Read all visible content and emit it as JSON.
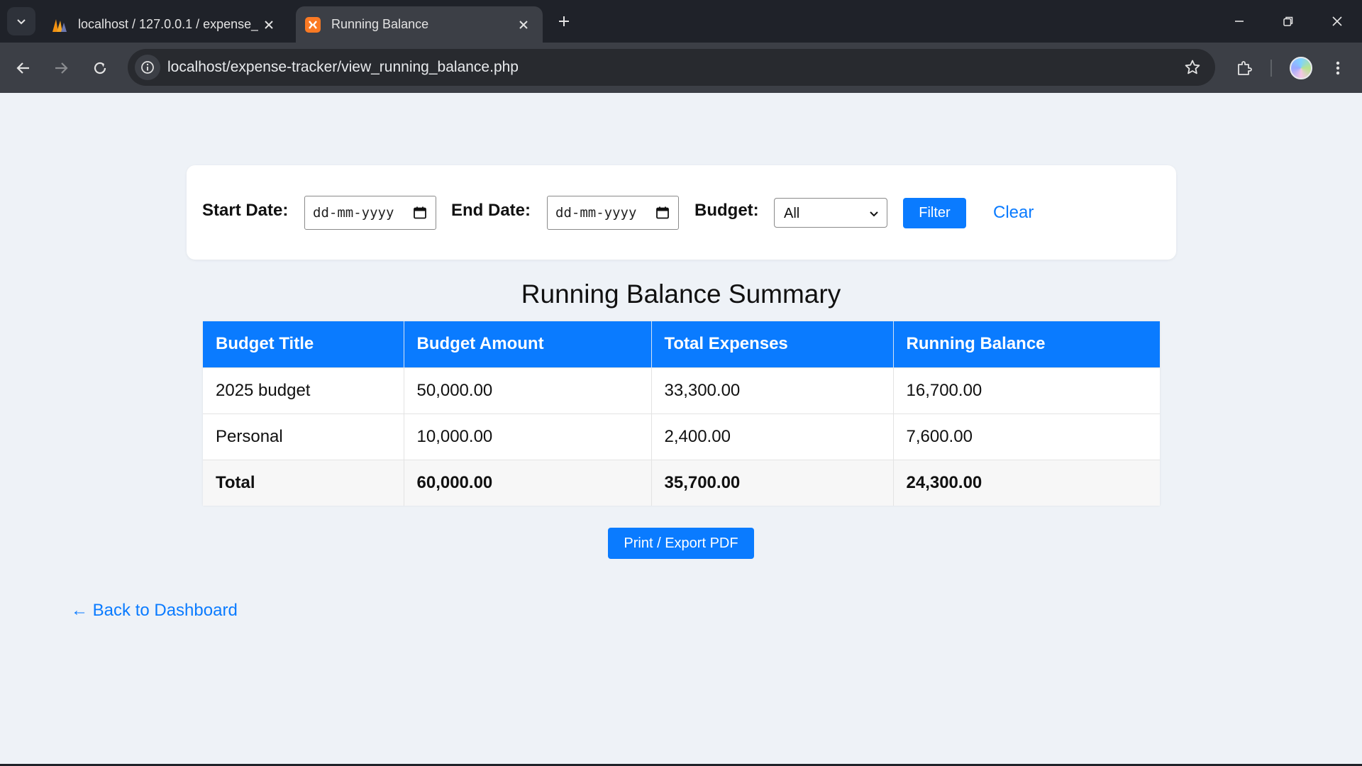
{
  "browser": {
    "tabs": [
      {
        "title": "localhost / 127.0.0.1 / expense_",
        "favicon": "phpmyadmin-icon",
        "active": false
      },
      {
        "title": "Running Balance",
        "favicon": "xampp-icon",
        "active": true
      }
    ],
    "url": "localhost/expense-tracker/view_running_balance.php"
  },
  "filter": {
    "start_label": "Start Date:",
    "start_value": "dd-mm-yyyy",
    "end_label": "End Date:",
    "end_value": "dd-mm-yyyy",
    "budget_label": "Budget:",
    "budget_selected": "All",
    "filter_button": "Filter",
    "clear_link": "Clear"
  },
  "summary": {
    "title": "Running Balance Summary",
    "headers": [
      "Budget Title",
      "Budget Amount",
      "Total Expenses",
      "Running Balance"
    ],
    "rows": [
      [
        "2025 budget",
        "50,000.00",
        "33,300.00",
        "16,700.00"
      ],
      [
        "Personal",
        "10,000.00",
        "2,400.00",
        "7,600.00"
      ]
    ],
    "total": [
      "Total",
      "60,000.00",
      "35,700.00",
      "24,300.00"
    ]
  },
  "actions": {
    "print_button": "Print / Export PDF",
    "back_link": "← Back to Dashboard"
  },
  "colors": {
    "accent": "#0a7bff",
    "page_background": "#eef2f7",
    "chrome_dark": "#1f2229",
    "chrome_toolbar": "#3c3f46"
  }
}
